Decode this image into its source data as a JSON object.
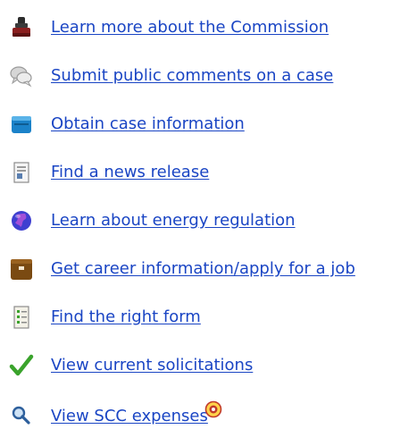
{
  "links": [
    {
      "label": "Learn more about the Commission",
      "icon": "commission-seal-icon"
    },
    {
      "label": "Submit public comments on a case",
      "icon": "comment-bubbles-icon"
    },
    {
      "label": "Obtain case information",
      "icon": "case-folder-icon"
    },
    {
      "label": "Find a news release",
      "icon": "news-document-icon"
    },
    {
      "label": "Learn about energy regulation",
      "icon": "globe-icon"
    },
    {
      "label": "Get career information/apply for a job",
      "icon": "briefcase-icon"
    },
    {
      "label": "Find the right form",
      "icon": "form-checklist-icon"
    },
    {
      "label": "View current solicitations",
      "icon": "checkmark-icon"
    },
    {
      "label": "View SCC expenses",
      "icon": "magnifier-icon",
      "badge_icon": "external-site-badge-icon"
    }
  ],
  "colors": {
    "link": "#1a45c4",
    "check": "#3aa32c",
    "briefcase": "#7a4a12",
    "globe": "#3f3fd0"
  }
}
